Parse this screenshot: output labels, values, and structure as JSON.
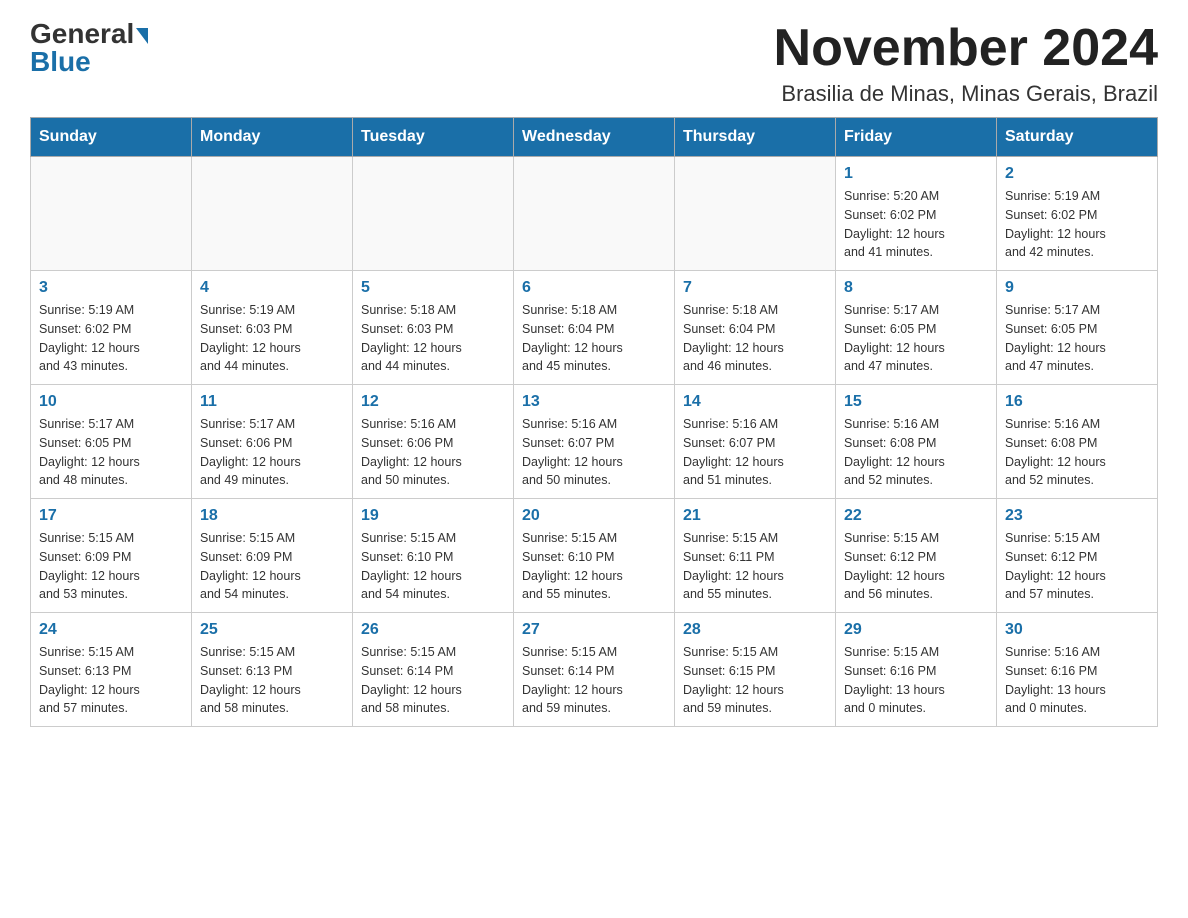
{
  "header": {
    "logo_general": "General",
    "logo_blue": "Blue",
    "month_title": "November 2024",
    "location": "Brasilia de Minas, Minas Gerais, Brazil"
  },
  "days_of_week": [
    "Sunday",
    "Monday",
    "Tuesday",
    "Wednesday",
    "Thursday",
    "Friday",
    "Saturday"
  ],
  "weeks": [
    {
      "days": [
        {
          "num": "",
          "info": ""
        },
        {
          "num": "",
          "info": ""
        },
        {
          "num": "",
          "info": ""
        },
        {
          "num": "",
          "info": ""
        },
        {
          "num": "",
          "info": ""
        },
        {
          "num": "1",
          "info": "Sunrise: 5:20 AM\nSunset: 6:02 PM\nDaylight: 12 hours\nand 41 minutes."
        },
        {
          "num": "2",
          "info": "Sunrise: 5:19 AM\nSunset: 6:02 PM\nDaylight: 12 hours\nand 42 minutes."
        }
      ]
    },
    {
      "days": [
        {
          "num": "3",
          "info": "Sunrise: 5:19 AM\nSunset: 6:02 PM\nDaylight: 12 hours\nand 43 minutes."
        },
        {
          "num": "4",
          "info": "Sunrise: 5:19 AM\nSunset: 6:03 PM\nDaylight: 12 hours\nand 44 minutes."
        },
        {
          "num": "5",
          "info": "Sunrise: 5:18 AM\nSunset: 6:03 PM\nDaylight: 12 hours\nand 44 minutes."
        },
        {
          "num": "6",
          "info": "Sunrise: 5:18 AM\nSunset: 6:04 PM\nDaylight: 12 hours\nand 45 minutes."
        },
        {
          "num": "7",
          "info": "Sunrise: 5:18 AM\nSunset: 6:04 PM\nDaylight: 12 hours\nand 46 minutes."
        },
        {
          "num": "8",
          "info": "Sunrise: 5:17 AM\nSunset: 6:05 PM\nDaylight: 12 hours\nand 47 minutes."
        },
        {
          "num": "9",
          "info": "Sunrise: 5:17 AM\nSunset: 6:05 PM\nDaylight: 12 hours\nand 47 minutes."
        }
      ]
    },
    {
      "days": [
        {
          "num": "10",
          "info": "Sunrise: 5:17 AM\nSunset: 6:05 PM\nDaylight: 12 hours\nand 48 minutes."
        },
        {
          "num": "11",
          "info": "Sunrise: 5:17 AM\nSunset: 6:06 PM\nDaylight: 12 hours\nand 49 minutes."
        },
        {
          "num": "12",
          "info": "Sunrise: 5:16 AM\nSunset: 6:06 PM\nDaylight: 12 hours\nand 50 minutes."
        },
        {
          "num": "13",
          "info": "Sunrise: 5:16 AM\nSunset: 6:07 PM\nDaylight: 12 hours\nand 50 minutes."
        },
        {
          "num": "14",
          "info": "Sunrise: 5:16 AM\nSunset: 6:07 PM\nDaylight: 12 hours\nand 51 minutes."
        },
        {
          "num": "15",
          "info": "Sunrise: 5:16 AM\nSunset: 6:08 PM\nDaylight: 12 hours\nand 52 minutes."
        },
        {
          "num": "16",
          "info": "Sunrise: 5:16 AM\nSunset: 6:08 PM\nDaylight: 12 hours\nand 52 minutes."
        }
      ]
    },
    {
      "days": [
        {
          "num": "17",
          "info": "Sunrise: 5:15 AM\nSunset: 6:09 PM\nDaylight: 12 hours\nand 53 minutes."
        },
        {
          "num": "18",
          "info": "Sunrise: 5:15 AM\nSunset: 6:09 PM\nDaylight: 12 hours\nand 54 minutes."
        },
        {
          "num": "19",
          "info": "Sunrise: 5:15 AM\nSunset: 6:10 PM\nDaylight: 12 hours\nand 54 minutes."
        },
        {
          "num": "20",
          "info": "Sunrise: 5:15 AM\nSunset: 6:10 PM\nDaylight: 12 hours\nand 55 minutes."
        },
        {
          "num": "21",
          "info": "Sunrise: 5:15 AM\nSunset: 6:11 PM\nDaylight: 12 hours\nand 55 minutes."
        },
        {
          "num": "22",
          "info": "Sunrise: 5:15 AM\nSunset: 6:12 PM\nDaylight: 12 hours\nand 56 minutes."
        },
        {
          "num": "23",
          "info": "Sunrise: 5:15 AM\nSunset: 6:12 PM\nDaylight: 12 hours\nand 57 minutes."
        }
      ]
    },
    {
      "days": [
        {
          "num": "24",
          "info": "Sunrise: 5:15 AM\nSunset: 6:13 PM\nDaylight: 12 hours\nand 57 minutes."
        },
        {
          "num": "25",
          "info": "Sunrise: 5:15 AM\nSunset: 6:13 PM\nDaylight: 12 hours\nand 58 minutes."
        },
        {
          "num": "26",
          "info": "Sunrise: 5:15 AM\nSunset: 6:14 PM\nDaylight: 12 hours\nand 58 minutes."
        },
        {
          "num": "27",
          "info": "Sunrise: 5:15 AM\nSunset: 6:14 PM\nDaylight: 12 hours\nand 59 minutes."
        },
        {
          "num": "28",
          "info": "Sunrise: 5:15 AM\nSunset: 6:15 PM\nDaylight: 12 hours\nand 59 minutes."
        },
        {
          "num": "29",
          "info": "Sunrise: 5:15 AM\nSunset: 6:16 PM\nDaylight: 13 hours\nand 0 minutes."
        },
        {
          "num": "30",
          "info": "Sunrise: 5:16 AM\nSunset: 6:16 PM\nDaylight: 13 hours\nand 0 minutes."
        }
      ]
    }
  ]
}
